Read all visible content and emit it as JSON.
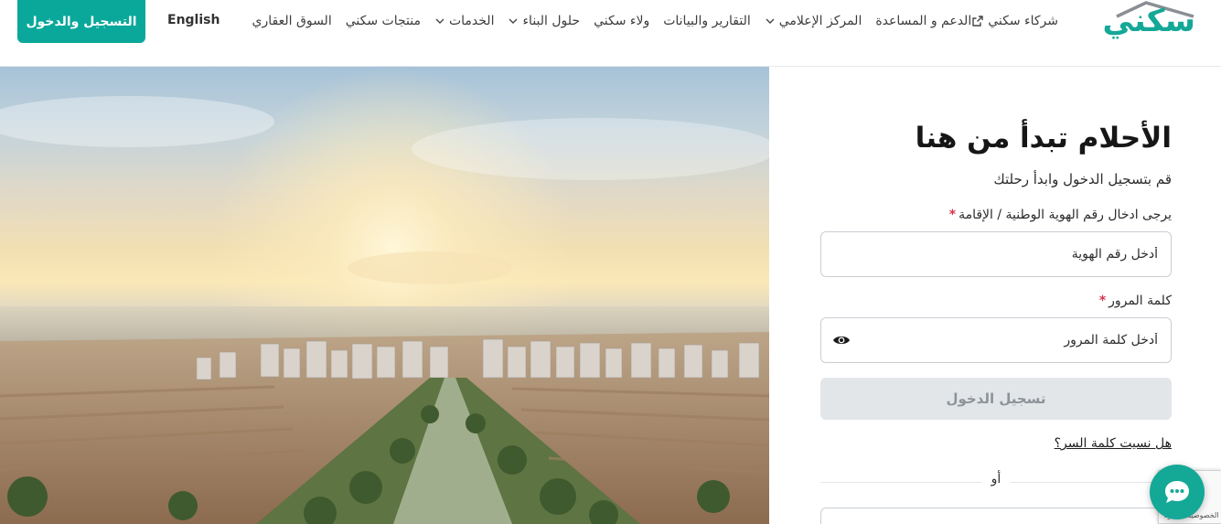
{
  "header": {
    "cta_label": "التسجيل والدخول",
    "lang_label": "English",
    "logo_text": "سكني",
    "nav": [
      {
        "label": "السوق العقاري"
      },
      {
        "label": "منتجات سكني"
      },
      {
        "label": "الخدمات"
      },
      {
        "label": "حلول البناء"
      },
      {
        "label": "ولاء سكني"
      },
      {
        "label": "التقارير والبيانات"
      },
      {
        "label": "المركز الإعلامي"
      },
      {
        "label": "الدعم و المساعدة"
      },
      {
        "label": "شركاء سكني"
      }
    ]
  },
  "login": {
    "title": "الأحلام تبدأ من هنا",
    "subtitle": "قم بتسجيل الدخول وابدأ رحلتك",
    "id_label": "يرجى ادخال رقم الهوية الوطنية / الإقامة",
    "id_placeholder": "أدخل رقم الهوية",
    "password_label": "كلمة المرور",
    "password_placeholder": "أدخل كلمة المرور",
    "required_mark": "*",
    "submit_label": "تسجيل الدخول",
    "forgot_label": "هل نسيت كلمة السر؟",
    "or_label": "أو"
  },
  "recaptcha": {
    "text": "الخصوصية - البنود"
  },
  "icons": {
    "chat": "chat-bubble-icon",
    "eye": "eye-icon",
    "external": "external-link-icon",
    "chevron": "chevron-down-icon"
  },
  "colors": {
    "brand": "#14a897",
    "cta": "#0aa89a",
    "required": "#d6334c",
    "disabled_button": "#e3e6e9"
  }
}
